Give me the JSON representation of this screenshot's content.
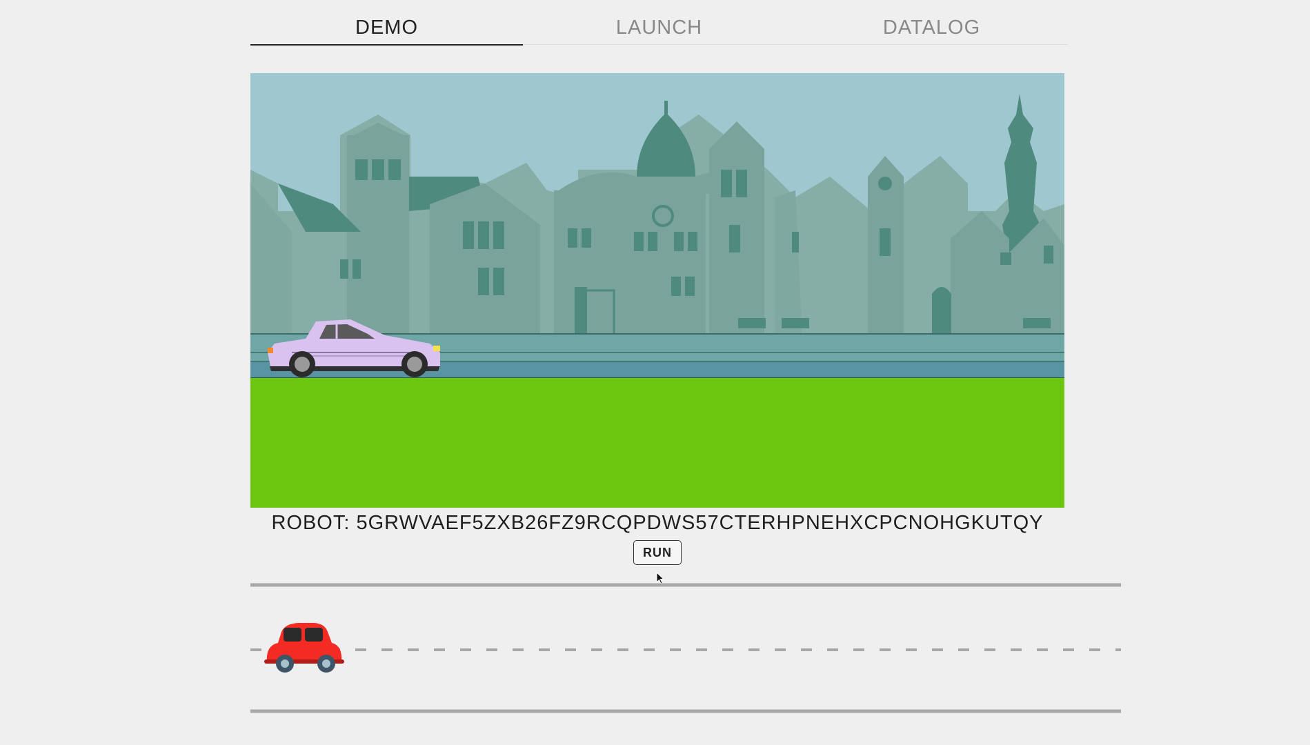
{
  "tabs": [
    {
      "label": "DEMO",
      "active": true
    },
    {
      "label": "LAUNCH",
      "active": false
    },
    {
      "label": "DATALOG",
      "active": false
    }
  ],
  "robot": {
    "prefix": "ROBOT:",
    "id": "5GRWVAEF5ZXB26FZ9RCQPDWS57CTERHPNEHXCPCNOHGKUTQY"
  },
  "run_button": {
    "label": "RUN"
  },
  "colors": {
    "sky": "#9fc7cf",
    "grass": "#6cc50f",
    "road": "#5894a2",
    "sidewalk": "#6fa7a6",
    "buildings_back": "#7fa8a0",
    "buildings_front": "#4f8a7e",
    "demo_car": "#d9c2ef",
    "progress_car": "#f32b22",
    "track_line": "#a8a8a8"
  }
}
